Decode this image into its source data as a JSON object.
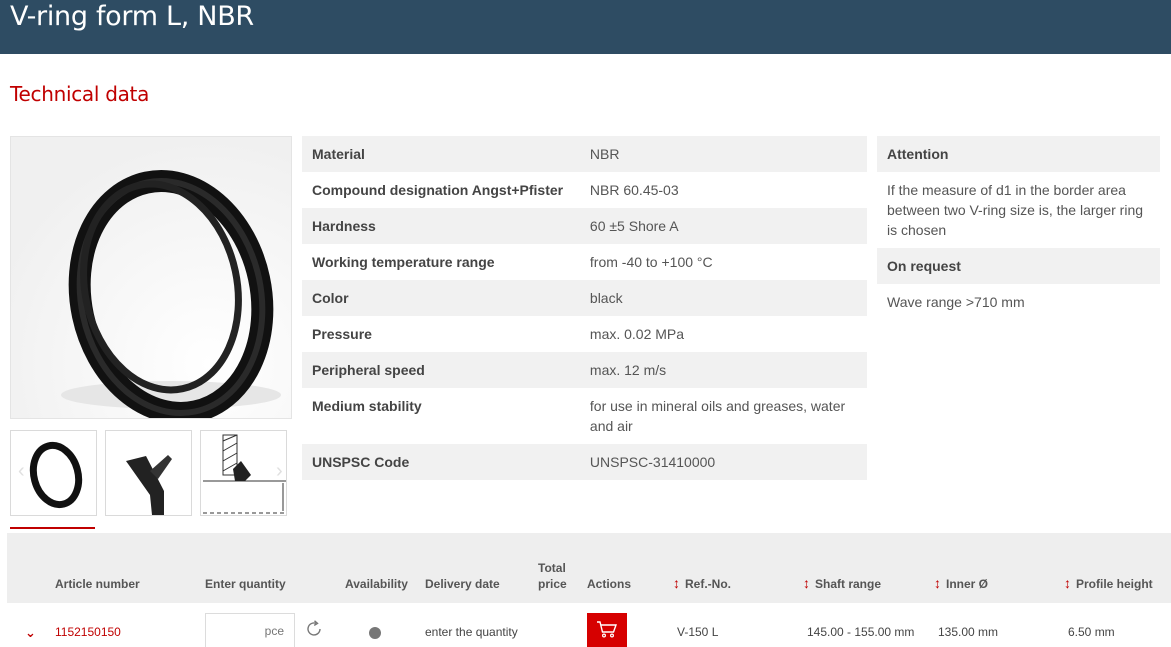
{
  "header": {
    "title": "V-ring form L, NBR"
  },
  "section": {
    "title": "Technical data"
  },
  "gallery": {
    "main_image": "v-ring-photo",
    "thumbnails": [
      "v-ring-photo",
      "v-ring-profile-section",
      "v-ring-technical-drawing"
    ]
  },
  "specs": [
    {
      "label": "Material",
      "value": "NBR"
    },
    {
      "label": "Compound designation Angst+Pfister",
      "value": "NBR 60.45-03"
    },
    {
      "label": "Hardness",
      "value": "60 ±5 Shore A"
    },
    {
      "label": "Working temperature range",
      "value": "from -40 to +100 °C"
    },
    {
      "label": "Color",
      "value": "black"
    },
    {
      "label": "Pressure",
      "value": "max. 0.02 MPa"
    },
    {
      "label": "Peripheral speed",
      "value": "max. 12 m/s"
    },
    {
      "label": "Medium stability",
      "value": "for use in mineral oils and greases, water and air"
    },
    {
      "label": "UNSPSC Code",
      "value": "UNSPSC-31410000"
    }
  ],
  "side": {
    "attention_title": "Attention",
    "attention_text": "If the measure of d1 in the border area between two V-ring size is, the larger ring is chosen",
    "request_title": "On request",
    "request_text": "Wave range >710 mm"
  },
  "table": {
    "headers": {
      "article": "Article number",
      "quantity": "Enter quantity",
      "availability": "Availability",
      "delivery": "Delivery date",
      "total_line1": "Total",
      "total_line2": "price",
      "actions": "Actions",
      "ref": "Ref.-No.",
      "shaft": "Shaft range",
      "inner": "Inner Ø",
      "profile": "Profile height"
    },
    "rows": [
      {
        "article": "1152150150",
        "quantity_placeholder": "pce",
        "delivery": "enter the quantity",
        "ref": "V-150 L",
        "shaft": "145.00 - 155.00 mm",
        "inner": "135.00 mm",
        "profile": "6.50 mm"
      }
    ]
  },
  "colors": {
    "header_bg": "#2e4c63",
    "accent": "#c00000",
    "cart": "#d60000"
  }
}
